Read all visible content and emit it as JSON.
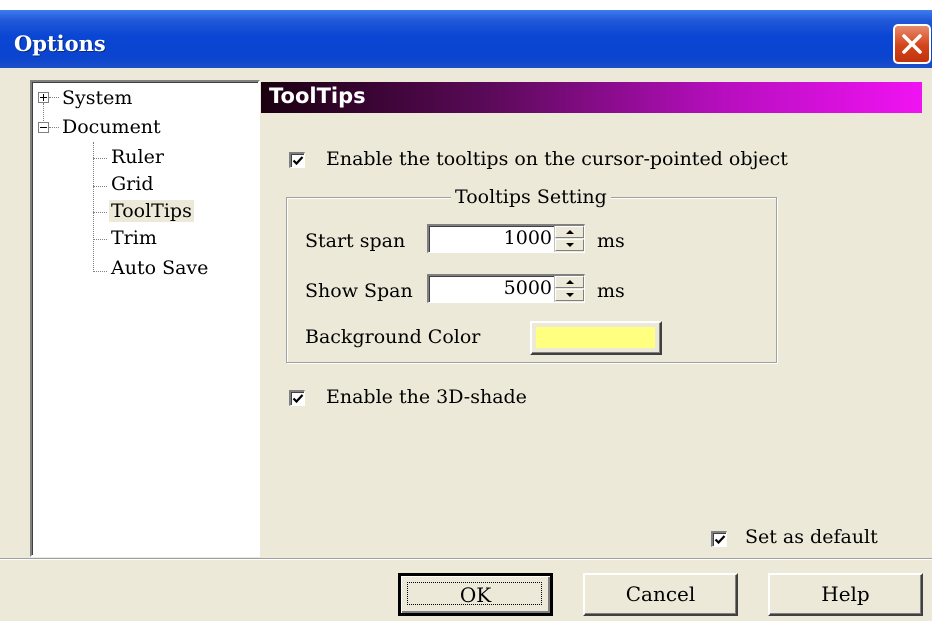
{
  "window": {
    "title": "Options"
  },
  "tree": {
    "items": [
      {
        "label": "System",
        "expander": "+"
      },
      {
        "label": "Document",
        "expander": "−"
      },
      {
        "label": "Ruler"
      },
      {
        "label": "Grid"
      },
      {
        "label": "ToolTips",
        "selected": true
      },
      {
        "label": "Trim"
      },
      {
        "label": "Auto Save"
      }
    ]
  },
  "panel": {
    "header": "ToolTips",
    "enable_tooltips": {
      "label": "Enable the tooltips on the cursor-pointed object",
      "checked": true
    },
    "group_title": "Tooltips Setting",
    "start_span": {
      "label": "Start span",
      "value": "1000",
      "unit": "ms"
    },
    "show_span": {
      "label": "Show Span",
      "value": "5000",
      "unit": "ms"
    },
    "background_color": {
      "label": "Background Color",
      "value": "#ffff80"
    },
    "enable_3d": {
      "label": "Enable the 3D-shade",
      "checked": true
    },
    "set_default": {
      "label": "Set as default",
      "checked": true
    }
  },
  "buttons": {
    "ok": "OK",
    "cancel": "Cancel",
    "help": "Help"
  },
  "colors": {
    "header_gradient_end": "#f013f2",
    "dialog_bg": "#ece9d8",
    "titlebar": "#0a46d4"
  }
}
